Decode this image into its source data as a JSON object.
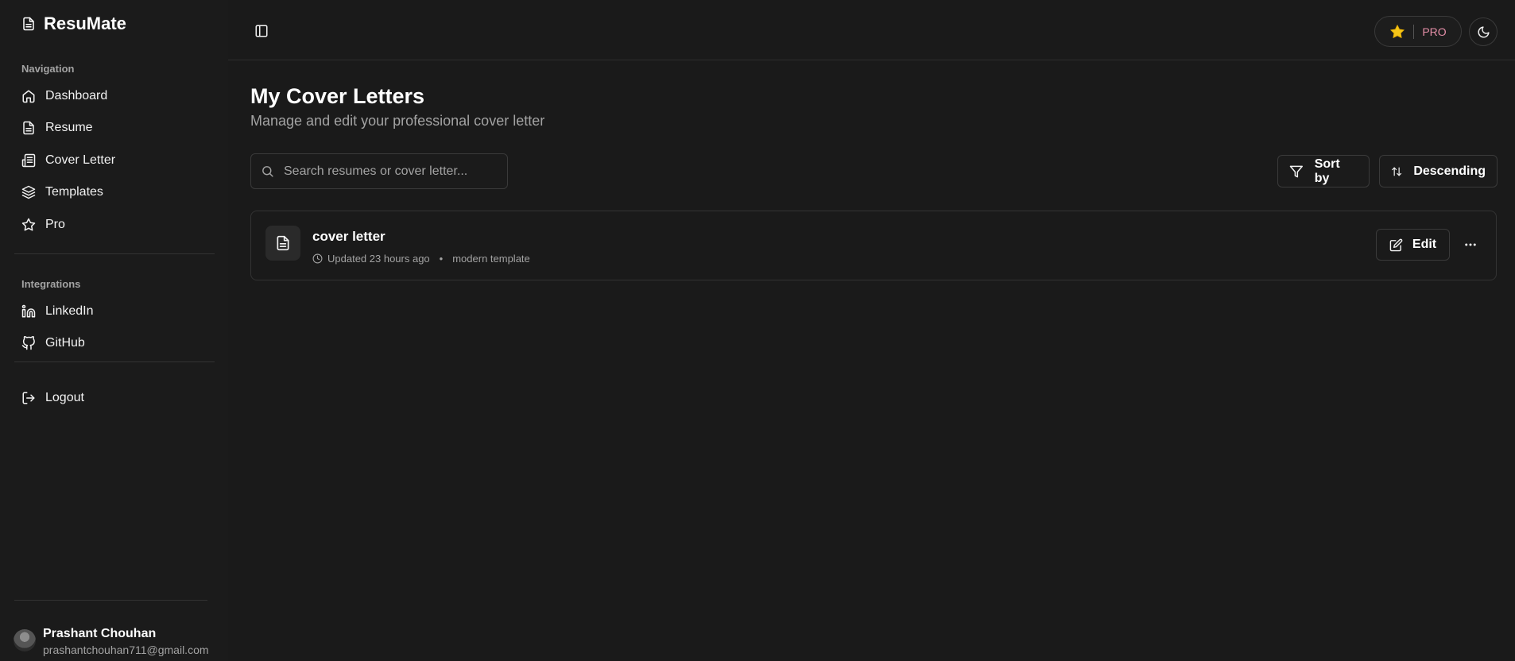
{
  "brand": {
    "name": "ResuMate"
  },
  "sidebar": {
    "navigation_label": "Navigation",
    "nav_items": [
      {
        "label": "Dashboard",
        "icon": "home-icon"
      },
      {
        "label": "Resume",
        "icon": "file-text-icon"
      },
      {
        "label": "Cover Letter",
        "icon": "newspaper-icon"
      },
      {
        "label": "Templates",
        "icon": "layers-icon"
      },
      {
        "label": "Pro",
        "icon": "star-icon"
      }
    ],
    "integrations_label": "Integrations",
    "integration_items": [
      {
        "label": "LinkedIn",
        "icon": "linkedin-icon"
      },
      {
        "label": "GitHub",
        "icon": "github-icon"
      }
    ],
    "logout_label": "Logout",
    "user": {
      "name": "Prashant Chouhan",
      "email": "prashantchouhan711@gmail.com"
    }
  },
  "header": {
    "pro_label": "PRO"
  },
  "main": {
    "title": "My Cover Letters",
    "subtitle": "Manage and edit your professional cover letter",
    "search_placeholder": "Search resumes or cover letter...",
    "sort_label": "Sort by",
    "order_label": "Descending",
    "items": [
      {
        "title": "cover letter",
        "updated": "Updated 23 hours ago",
        "template": "modern template",
        "edit_label": "Edit"
      }
    ]
  },
  "colors": {
    "background": "#1a1a1a",
    "pro_text": "#e58fa8",
    "star": "#f5c518"
  }
}
